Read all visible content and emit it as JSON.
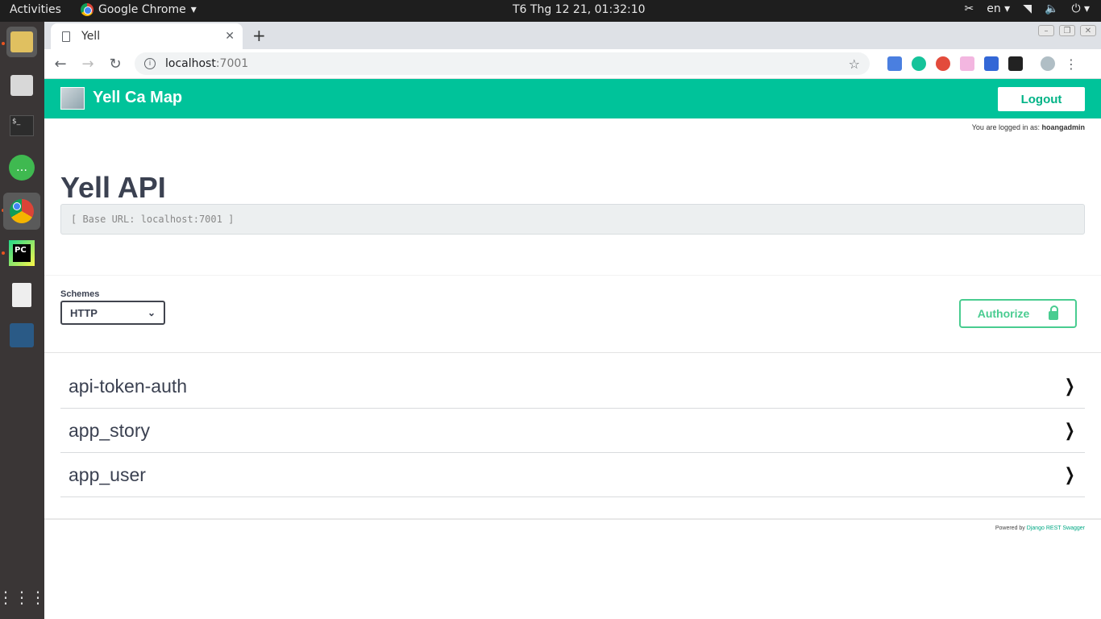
{
  "system": {
    "activities": "Activities",
    "app_name": "Google Chrome",
    "clock": "T6 Thg 12 21, 01:32:10",
    "language": "en"
  },
  "browser": {
    "tab_title": "Yell",
    "url_host": "localhost",
    "url_port": ":7001"
  },
  "header": {
    "brand": "Yell Ca Map",
    "logout_label": "Logout",
    "logged_in_prefix": "You are logged in as:",
    "username": "hoangadmin"
  },
  "api": {
    "title": "Yell API",
    "base_url": "[ Base URL: localhost:7001 ]"
  },
  "schemes": {
    "label": "Schemes",
    "selected": "HTTP"
  },
  "authorize_label": "Authorize",
  "tags": [
    {
      "name": "api-token-auth"
    },
    {
      "name": "app_story"
    },
    {
      "name": "app_user"
    }
  ],
  "footer": {
    "prefix": "Powered by",
    "link": "Django REST Swagger"
  },
  "colors": {
    "header": "#00c39a",
    "authorize": "#49cc90"
  }
}
